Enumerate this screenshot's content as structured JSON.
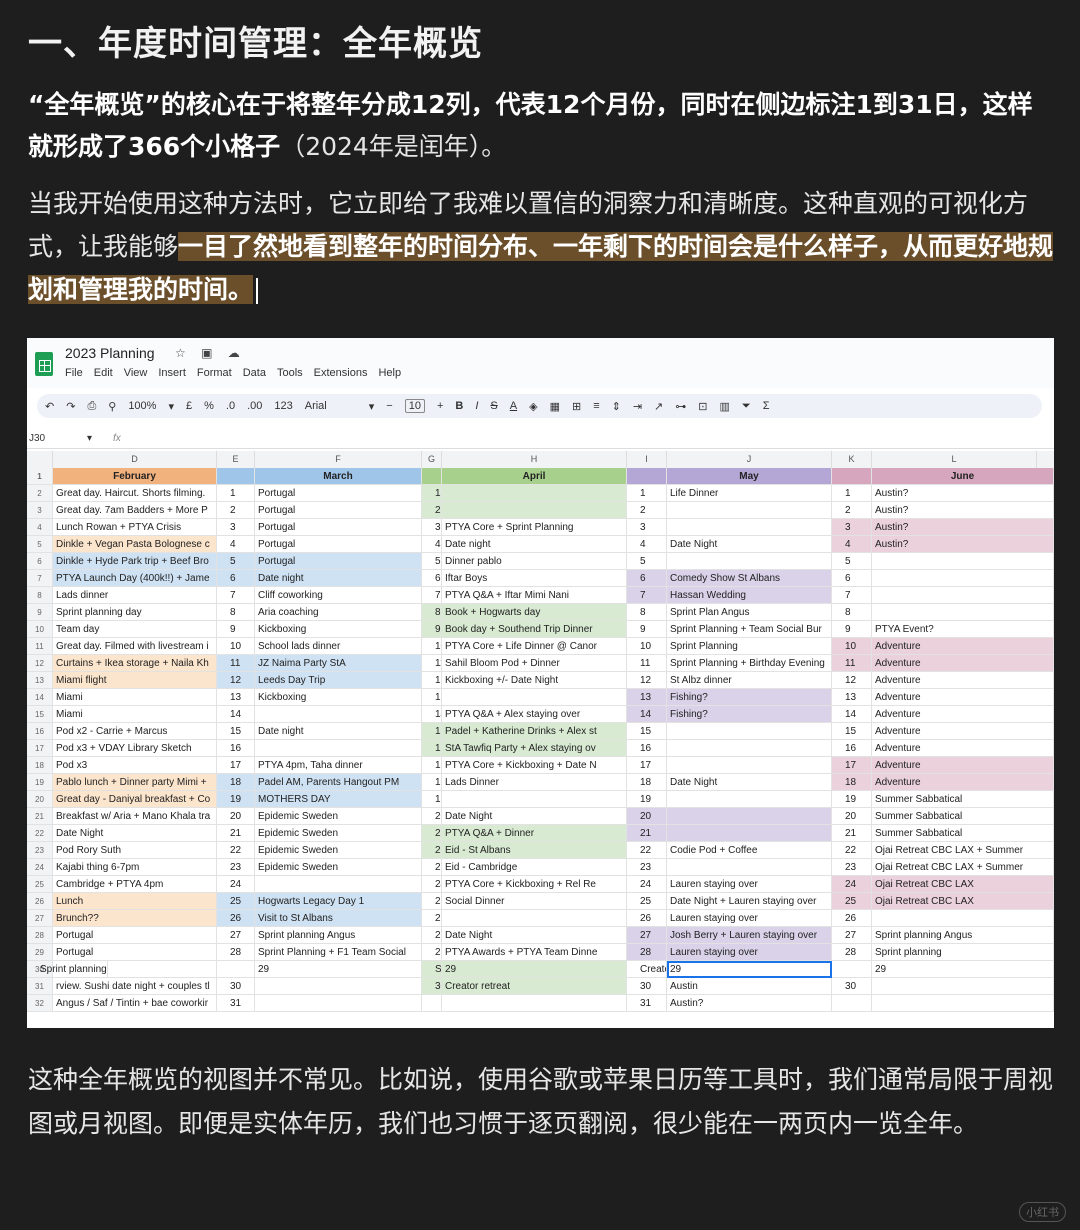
{
  "article": {
    "title": "一、年度时间管理：全年概览",
    "p1_bold": "“全年概览”的核心在于将整年分成12列，代表12个月份，同时在侧边标注1到31日，这样就形成了366个小格子",
    "p1_normal": "（2024年是闰年）。",
    "p2_prefix": "当我开始使用这种方法时，它立即给了我难以置信的洞察力和清晰度。这种直观的可视化方式，让我能够",
    "p2_highlight": "一目了然地看到整年的时间分布、一年剩下的时间会是什么样子，从而更好地规划和管理我的时间。",
    "p3": "这种全年概览的视图并不常见。比如说，使用谷歌或苹果日历等工具时，我们通常局限于周视图或月视图。即便是实体年历，我们也习惯于逐页翻阅，很少能在一两页内一览全年。",
    "watermark": "小红书"
  },
  "sheet": {
    "doc_title": "2023 Planning",
    "title_icons": "☆ ▣ ☁",
    "menus": [
      "File",
      "Edit",
      "View",
      "Insert",
      "Format",
      "Data",
      "Tools",
      "Extensions",
      "Help"
    ],
    "toolbar": {
      "zoom": "100%",
      "currency": "£",
      "percent": "%",
      "dec_less": ".0",
      "dec_more": ".00",
      "num_format": "123",
      "font": "Arial",
      "font_size": "10",
      "bold": "B",
      "italic": "I",
      "strike": "S",
      "text_color": "A"
    },
    "cell_ref": "J30",
    "fx": "fx",
    "columns": [
      "D",
      "E",
      "F",
      "G",
      "H",
      "I",
      "J",
      "K",
      "L"
    ],
    "header_row": [
      "1",
      "February",
      "",
      "March",
      "",
      "April",
      "",
      "May",
      "",
      "June"
    ],
    "rows": [
      [
        "2",
        "Great day. Haircut. Shorts filming.",
        "1",
        "Portugal",
        "1",
        "",
        "1",
        "Life Dinner",
        "1",
        "Austin?"
      ],
      [
        "3",
        "Great day. 7am Badders + More P",
        "2",
        "Portugal",
        "2",
        "",
        "2",
        "",
        "2",
        "Austin?"
      ],
      [
        "4",
        "Lunch Rowan + PTYA Crisis",
        "3",
        "Portugal",
        "3",
        "PTYA Core + Sprint Planning",
        "3",
        "",
        "3",
        "Austin?"
      ],
      [
        "5",
        "Dinkle + Vegan Pasta Bolognese c",
        "4",
        "Portugal",
        "4",
        "Date night",
        "4",
        "Date Night",
        "4",
        "Austin?"
      ],
      [
        "6",
        "Dinkle + Hyde Park trip + Beef Bro",
        "5",
        "Portugal",
        "5",
        "Dinner pablo",
        "5",
        "",
        "5",
        ""
      ],
      [
        "7",
        "PTYA Launch Day (400k!!) + Jame",
        "6",
        "Date night",
        "6",
        "Iftar Boys",
        "6",
        "Comedy Show St Albans",
        "6",
        ""
      ],
      [
        "8",
        "Lads dinner",
        "7",
        "Cliff coworking",
        "7",
        "PTYA Q&A + Iftar Mimi Nani",
        "7",
        "Hassan Wedding",
        "7",
        ""
      ],
      [
        "9",
        "Sprint planning day",
        "8",
        "Aria coaching",
        "8",
        "Book + Hogwarts day",
        "8",
        "Sprint Plan Angus",
        "8",
        ""
      ],
      [
        "10",
        "Team day",
        "9",
        "Kickboxing",
        "9",
        "Book day + Southend Trip Dinner",
        "9",
        "Sprint Planning + Team Social Bur",
        "9",
        "PTYA Event?"
      ],
      [
        "11",
        "Great day. Filmed with livestream i",
        "10",
        "School lads dinner",
        "10",
        "PTYA Core + Life Dinner @ Canor",
        "10",
        "Sprint Planning",
        "10",
        "Adventure"
      ],
      [
        "12",
        "Curtains + Ikea storage + Naila Kh",
        "11",
        "JZ Naima Party StA",
        "11",
        "Sahil Bloom Pod + Dinner",
        "11",
        "Sprint Planning + Birthday Evening",
        "11",
        "Adventure"
      ],
      [
        "13",
        "Miami flight",
        "12",
        "Leeds Day Trip",
        "12",
        "Kickboxing +/- Date Night",
        "12",
        "St Albz dinner",
        "12",
        "Adventure"
      ],
      [
        "14",
        "Miami",
        "13",
        "Kickboxing",
        "13",
        "",
        "13",
        "Fishing?",
        "13",
        "Adventure"
      ],
      [
        "15",
        "Miami",
        "14",
        "",
        "14",
        "PTYA Q&A + Alex staying over",
        "14",
        "Fishing?",
        "14",
        "Adventure"
      ],
      [
        "16",
        "Pod x2 - Carrie + Marcus",
        "15",
        "Date night",
        "15",
        "Padel + Katherine Drinks + Alex st",
        "15",
        "",
        "15",
        "Adventure"
      ],
      [
        "17",
        "Pod x3 + VDAY Library Sketch",
        "16",
        "",
        "16",
        "StA Tawfiq Party + Alex staying ov",
        "16",
        "",
        "16",
        "Adventure"
      ],
      [
        "18",
        "Pod x3",
        "17",
        "PTYA 4pm, Taha dinner",
        "17",
        "PTYA Core + Kickboxing + Date N",
        "17",
        "",
        "17",
        "Adventure"
      ],
      [
        "19",
        "Pablo lunch + Dinner party Mimi +",
        "18",
        "Padel AM, Parents Hangout PM",
        "18",
        "Lads Dinner",
        "18",
        "Date Night",
        "18",
        "Adventure"
      ],
      [
        "20",
        "Great day - Daniyal breakfast + Co",
        "19",
        "MOTHERS DAY",
        "19",
        "",
        "19",
        "",
        "19",
        "Summer Sabbatical"
      ],
      [
        "21",
        "Breakfast w/ Aria + Mano Khala tra",
        "20",
        "Epidemic Sweden",
        "20",
        "Date Night",
        "20",
        "",
        "20",
        "Summer Sabbatical"
      ],
      [
        "22",
        "Date Night",
        "21",
        "Epidemic Sweden",
        "21",
        "PTYA Q&A + Dinner",
        "21",
        "",
        "21",
        "Summer Sabbatical"
      ],
      [
        "23",
        "Pod Rory Suth",
        "22",
        "Epidemic Sweden",
        "22",
        "Eid - St Albans",
        "22",
        "Codie Pod + Coffee",
        "22",
        "Ojai Retreat CBC LAX + Summer"
      ],
      [
        "24",
        "Kajabi thing 6-7pm",
        "23",
        "Epidemic Sweden",
        "23",
        "Eid - Cambridge",
        "23",
        "",
        "23",
        "Ojai Retreat CBC LAX + Summer"
      ],
      [
        "25",
        "Cambridge + PTYA 4pm",
        "24",
        "",
        "24",
        "PTYA Core + Kickboxing + Rel Re",
        "24",
        "Lauren staying over",
        "24",
        "Ojai Retreat CBC LAX"
      ],
      [
        "26",
        "Lunch",
        "25",
        "Hogwarts Legacy Day 1",
        "25",
        "Social Dinner",
        "25",
        "Date Night + Lauren staying over",
        "25",
        "Ojai Retreat CBC LAX"
      ],
      [
        "27",
        "Brunch??",
        "26",
        "Visit to St Albans",
        "26",
        "",
        "26",
        "Lauren staying over",
        "26",
        ""
      ],
      [
        "28",
        "Portugal",
        "27",
        "Sprint planning Angus",
        "27",
        "Date Night",
        "27",
        "Josh Berry + Lauren staying over",
        "27",
        "Sprint planning Angus"
      ],
      [
        "29",
        "Portugal",
        "28",
        "Sprint Planning + F1 Team Social",
        "28",
        "PTYA Awards + PTYA Team Dinne",
        "28",
        "Lauren staying over",
        "28",
        "Sprint planning"
      ],
      [
        "30",
        "",
        "",
        "29",
        "Sprint Planning",
        "29",
        "Creator retreat",
        "29",
        "",
        "29",
        "Sprint planning"
      ],
      [
        "31",
        "rview. Sushi date night + couples tl",
        "30",
        "",
        "30",
        "Creator retreat",
        "30",
        "Austin",
        "30",
        ""
      ],
      [
        "32",
        "Angus / Saf / Tintin + bae coworkir",
        "31",
        "",
        "",
        "",
        "31",
        "Austin?",
        "",
        ""
      ]
    ],
    "colors": {
      "feb_header": "#f2b27e",
      "mar_header": "#9fc5e8",
      "apr_header": "#a8d08d",
      "may_header": "#b4a7d6",
      "jun_header": "#d5a6bd",
      "feb_light": "#fce5cd",
      "mar_light": "#cfe2f3",
      "apr_light": "#d9ead3",
      "may_light": "#d9d2e9",
      "jun_light": "#ead1dc"
    }
  }
}
